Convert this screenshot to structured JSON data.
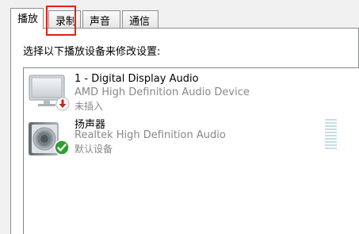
{
  "tabs": [
    {
      "label": "播放"
    },
    {
      "label": "录制"
    },
    {
      "label": "声音"
    },
    {
      "label": "通信"
    }
  ],
  "instruction": "选择以下播放设备来修改设置:",
  "devices": [
    {
      "name": "1 - Digital Display Audio",
      "description": "AMD High Definition Audio Device",
      "status": "未插入",
      "icon": "monitor-icon",
      "badge": "unplugged-red-arrow-icon"
    },
    {
      "name": "扬声器",
      "description": "Realtek High Definition Audio",
      "status": "默认设备",
      "icon": "speaker-icon",
      "badge": "default-green-check-icon"
    }
  ],
  "colors": {
    "highlight": "#e0201a",
    "check_green": "#2e9e2e",
    "unplugged_red": "#c0281f",
    "meter": "#c6dde5"
  }
}
